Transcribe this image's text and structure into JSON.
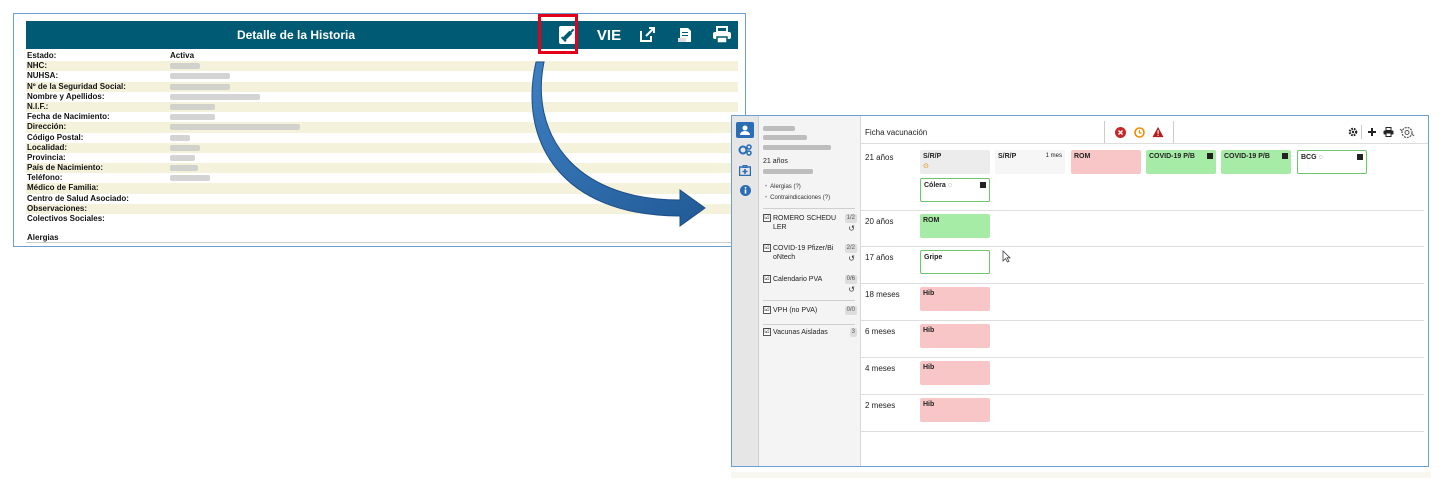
{
  "history": {
    "title": "Detalle de la Historia",
    "toolbar": {
      "vacc_icon": "syringe-icon",
      "vie_label": "VIE",
      "external_icon": "external-link-icon",
      "doc_icon": "document-stamp-icon",
      "print_icon": "printer-icon"
    },
    "fields": [
      {
        "label": "Estado:",
        "value": "Activa"
      },
      {
        "label": "NHC:",
        "value": ""
      },
      {
        "label": "NUHSA:",
        "value": ""
      },
      {
        "label": "Nº de la Seguridad Social:",
        "value": ""
      },
      {
        "label": "Nombre y Apellidos:",
        "value": ""
      },
      {
        "label": "N.I.F.:",
        "value": ""
      },
      {
        "label": "Fecha de Nacimiento:",
        "value": ""
      },
      {
        "label": "Dirección:",
        "value": ""
      },
      {
        "label": "Código Postal:",
        "value": ""
      },
      {
        "label": "Localidad:",
        "value": ""
      },
      {
        "label": "Provincia:",
        "value": ""
      },
      {
        "label": "País de Nacimiento:",
        "value": ""
      },
      {
        "label": "Teléfono:",
        "value": ""
      },
      {
        "label": "Médico de Familia:",
        "value": ""
      },
      {
        "label": "Centro de Salud Asociado:",
        "value": ""
      },
      {
        "label": "Observaciones:",
        "value": ""
      },
      {
        "label": "Colectivos Sociales:",
        "value": ""
      }
    ],
    "alergias_label": "Alergias"
  },
  "vaccination": {
    "title": "Ficha vacunación",
    "patient": {
      "age": "21 años",
      "alergias": "Alergias (?)",
      "contraindicaciones": "Contraindicaciones (?)"
    },
    "calendars": [
      {
        "name": "ROMERO SCHEDU LER",
        "count": "1/2",
        "checked": "☑"
      },
      {
        "name": "COVID-19 Pfizer/Bi oNtech",
        "count": "2/2",
        "checked": "☑"
      },
      {
        "name": "Calendario PVA",
        "count": "0/6",
        "checked": "☑"
      },
      {
        "name": "VPH (no PVA)",
        "count": "0/0",
        "checked": "☑"
      },
      {
        "name": "Vacunas Aisladas",
        "count": "3",
        "checked": "☑"
      }
    ],
    "rows": [
      {
        "age": "21 años",
        "cards": [
          {
            "label": "S/R/P",
            "style": "grey",
            "sub": "⊙"
          },
          {
            "label": "S/R/P",
            "style": "plain",
            "dose": "1 mes"
          },
          {
            "label": "ROM",
            "style": "red"
          },
          {
            "label": "COVID-19 P/B",
            "style": "green"
          },
          {
            "label": "COVID-19 P/B",
            "style": "green"
          },
          {
            "label": "BCG ◌",
            "style": "white-g"
          },
          {
            "label": "Cólera ◌",
            "style": "white-g"
          }
        ]
      },
      {
        "age": "20 años",
        "cards": [
          {
            "label": "ROM",
            "style": "green"
          }
        ]
      },
      {
        "age": "17 años",
        "cards": [
          {
            "label": "Gripe",
            "style": "white-g"
          }
        ]
      },
      {
        "age": "18 meses",
        "cards": [
          {
            "label": "Hib",
            "style": "red"
          }
        ]
      },
      {
        "age": "6 meses",
        "cards": [
          {
            "label": "Hib",
            "style": "red"
          }
        ]
      },
      {
        "age": "4 meses",
        "cards": [
          {
            "label": "Hib",
            "style": "red"
          }
        ]
      },
      {
        "age": "2 meses",
        "cards": [
          {
            "label": "Hib",
            "style": "red"
          }
        ]
      }
    ],
    "status_icons": [
      "error-circle-icon",
      "clock-warning-icon",
      "alert-triangle-icon"
    ],
    "action_icons": [
      "gear-icon",
      "plus-icon",
      "printer-icon",
      "settings-cycle-icon"
    ],
    "rail_icons": [
      "user-icon",
      "cogs-icon",
      "medical-kit-icon",
      "info-icon"
    ]
  },
  "colors": {
    "header": "#005a73",
    "highlight_box": "#e2001a",
    "arrow": "#2e6aa8",
    "card_red": "#f8c6c6",
    "card_green": "#a6eca6"
  }
}
